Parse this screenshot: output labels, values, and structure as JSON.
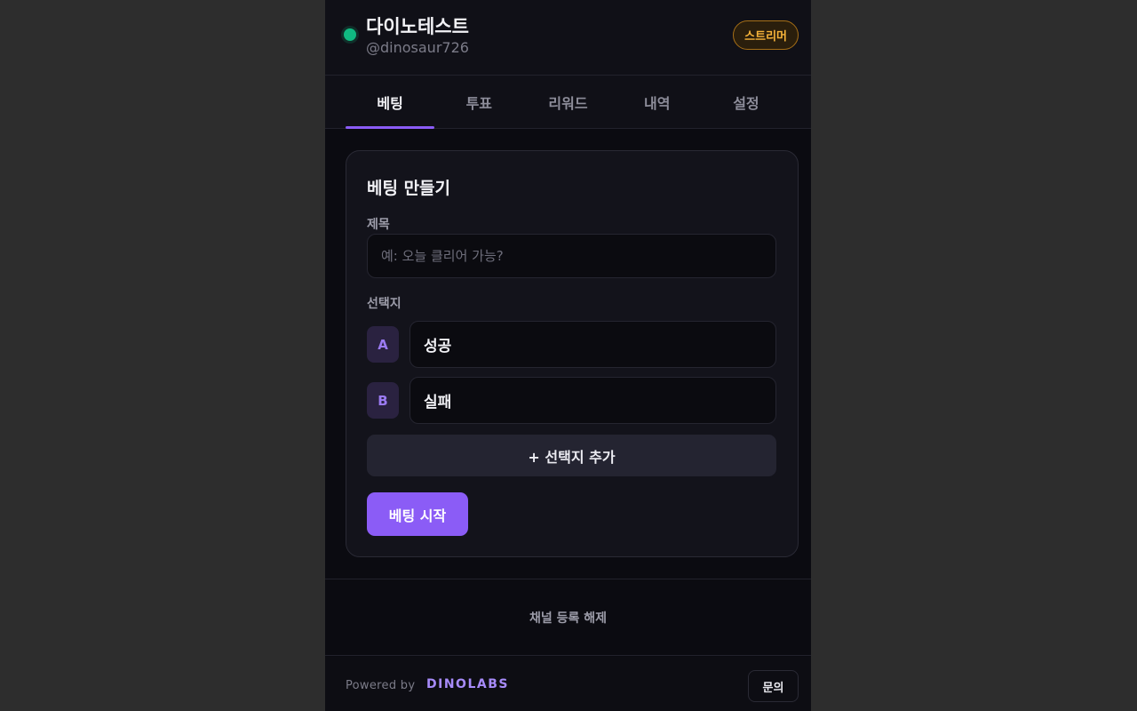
{
  "header": {
    "channel_name": "다이노테스트",
    "channel_handle": "@dinosaur726",
    "role_badge": "스트리머",
    "status_color": "#10b981"
  },
  "tabs": [
    {
      "label": "베팅",
      "active": true
    },
    {
      "label": "투표",
      "active": false
    },
    {
      "label": "리워드",
      "active": false
    },
    {
      "label": "내역",
      "active": false
    },
    {
      "label": "설정",
      "active": false
    }
  ],
  "bet_form": {
    "title": "베팅 만들기",
    "title_field_label": "제목",
    "title_field_placeholder": "예: 오늘 클리어 가능?",
    "title_field_value": "",
    "options_label": "선택지",
    "options": [
      {
        "letter": "A",
        "value": "성공"
      },
      {
        "letter": "B",
        "value": "실패"
      }
    ],
    "add_option_label": "+ 선택지 추가",
    "start_label": "베팅 시작"
  },
  "unregister_label": "채널 등록 해제",
  "footer": {
    "powered_by": "Powered by",
    "brand": "DINOLABS",
    "contact_label": "문의"
  },
  "colors": {
    "accent": "#8b5cf6",
    "badge": "#f5b33a",
    "background": "#0b0b11"
  }
}
